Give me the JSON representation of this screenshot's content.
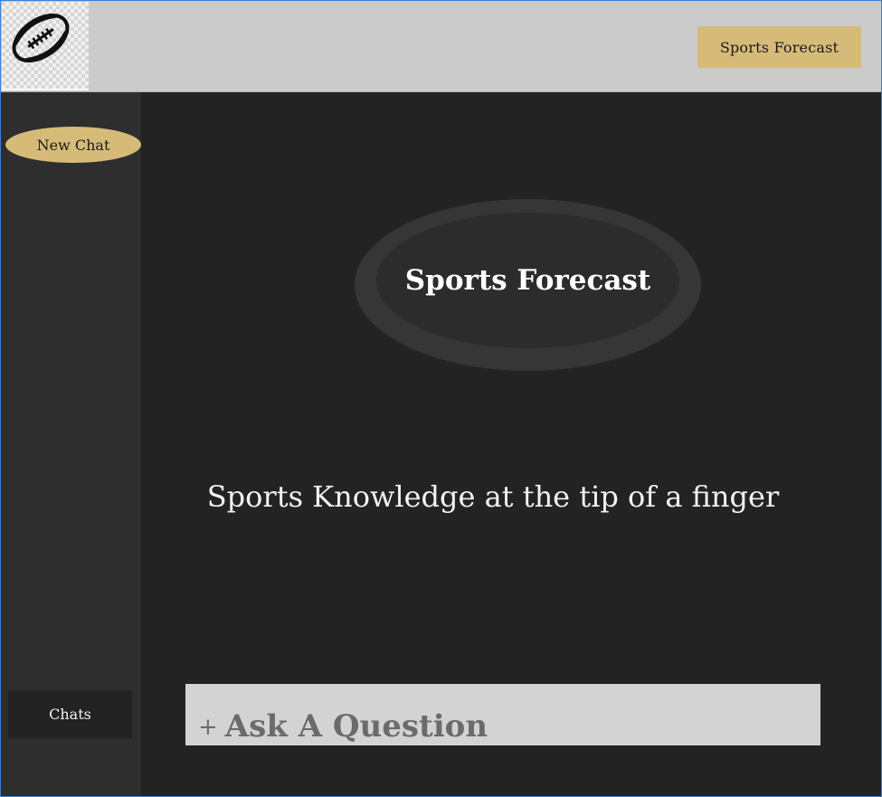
{
  "header": {
    "logo_icon": "football-icon",
    "forecast_button_label": "Sports Forecast"
  },
  "sidebar": {
    "new_chat_label": "New Chat",
    "chats_label": "Chats"
  },
  "main": {
    "title": "Sports Forecast",
    "tagline": "Sports Knowledge at the tip of a finger",
    "ask": {
      "icon": "+",
      "label": "Ask A Question"
    }
  },
  "colors": {
    "accent": "#d6bb78",
    "header_bg": "#cbcbcb",
    "sidebar_bg": "#2e2e2e",
    "main_bg": "#232323",
    "input_bg": "#d3d3d3"
  }
}
